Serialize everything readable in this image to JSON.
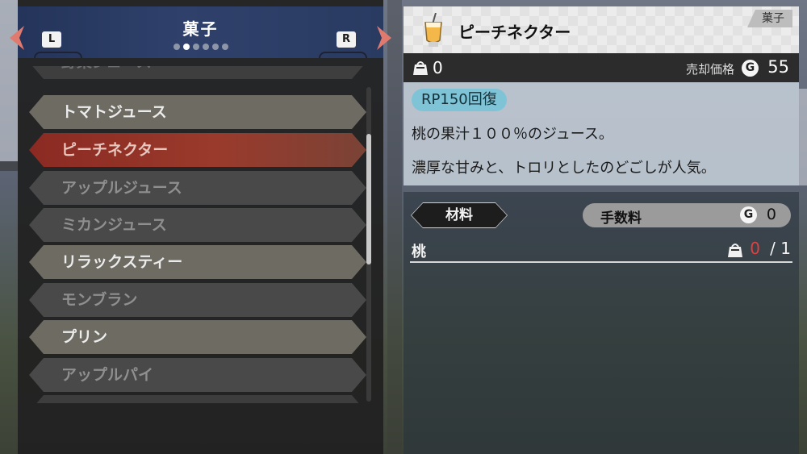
{
  "category": {
    "title": "菓子",
    "page_count": 6,
    "active_page": 2,
    "prev_key": "L",
    "next_key": "R"
  },
  "list": {
    "items": [
      {
        "label": "野菜ジュース",
        "state": "partial"
      },
      {
        "label": "トマトジュース",
        "state": "owned"
      },
      {
        "label": "ピーチネクター",
        "state": "selected"
      },
      {
        "label": "アップルジュース",
        "state": "unowned"
      },
      {
        "label": "ミカンジュース",
        "state": "unowned"
      },
      {
        "label": "リラックスティー",
        "state": "owned"
      },
      {
        "label": "モンブラン",
        "state": "unowned"
      },
      {
        "label": "プリン",
        "state": "owned"
      },
      {
        "label": "アップルパイ",
        "state": "unowned"
      },
      {
        "label": "",
        "state": "partial"
      }
    ]
  },
  "detail": {
    "item_icon": "drink-glass-icon",
    "item_name": "ピーチネクター",
    "category_tag": "菓子",
    "owned_count": "0",
    "sell_label": "売却価格",
    "coin_symbol": "G",
    "sell_price": "55",
    "effect": "RP150回復",
    "description": [
      "桃の果汁１００％のジュース。",
      "濃厚な甘みと、トロリとしたのどごしが人気。"
    ]
  },
  "materials": {
    "header_label": "材料",
    "fee_label": "手数料",
    "fee_value": "0",
    "rows": [
      {
        "name": "桃",
        "have": "0",
        "need": "/ 1"
      }
    ]
  },
  "colors": {
    "selected_row": "#8a2a22",
    "effect_badge": "#7fc4d6",
    "shortage": "#e04040",
    "header_blue": "#2f416b"
  }
}
